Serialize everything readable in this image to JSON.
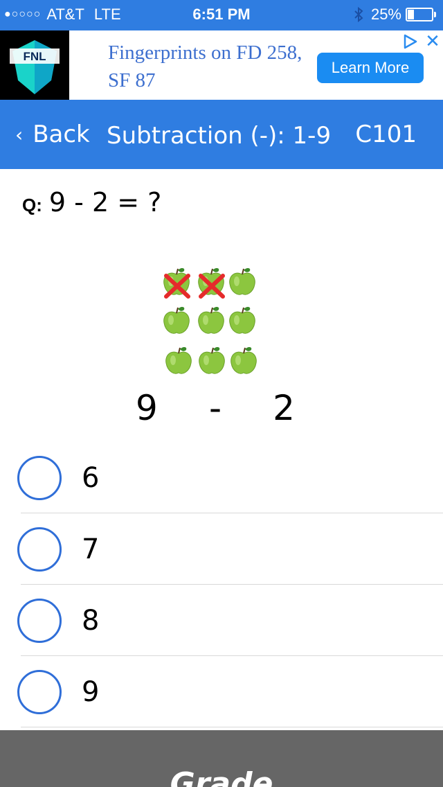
{
  "status_bar": {
    "signal_dots": "●○○○○",
    "carrier": "AT&T",
    "network": "LTE",
    "time": "6:51 PM",
    "battery_percent": "25%",
    "battery_level": 0.25
  },
  "ad": {
    "logo_text": "FNL",
    "text": "Fingerprints on FD 258, SF 87",
    "button_label": "Learn More",
    "close_label": "✕"
  },
  "nav": {
    "back_label": "Back",
    "title": "Subtraction (-): 1-9",
    "code": "C101"
  },
  "question": {
    "prefix": "Q:",
    "text": "9 - 2 = ?"
  },
  "illustration": {
    "minuend": "9",
    "operator": "-",
    "subtrahend": "2",
    "apple_color": "#8cc63f",
    "cross_color": "#e52b2b"
  },
  "answers": [
    {
      "label": "6"
    },
    {
      "label": "7"
    },
    {
      "label": "8"
    },
    {
      "label": "9"
    }
  ],
  "grade_label": "Grade",
  "colors": {
    "primary": "#2f7de1",
    "radio_border": "#2f6ed8",
    "grade_bar": "#666666"
  }
}
